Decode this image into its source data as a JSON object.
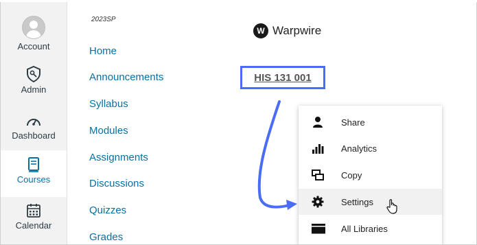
{
  "global_nav": {
    "items": [
      {
        "label": "Account",
        "icon": "avatar"
      },
      {
        "label": "Admin",
        "icon": "shield-icon"
      },
      {
        "label": "Dashboard",
        "icon": "speedometer-icon"
      },
      {
        "label": "Courses",
        "icon": "book-icon",
        "active": true
      },
      {
        "label": "Calendar",
        "icon": "calendar-icon"
      }
    ]
  },
  "course_nav": {
    "term": "2023SP",
    "items": [
      "Home",
      "Announcements",
      "Syllabus",
      "Modules",
      "Assignments",
      "Discussions",
      "Quizzes",
      "Grades"
    ]
  },
  "warpwire": {
    "badge": "W",
    "name": "Warpwire",
    "course_title": "HIS 131 001"
  },
  "menu": {
    "items": [
      {
        "label": "Share",
        "icon": "person-icon"
      },
      {
        "label": "Analytics",
        "icon": "bar-chart-icon"
      },
      {
        "label": "Copy",
        "icon": "copy-icon"
      },
      {
        "label": "Settings",
        "icon": "gear-icon",
        "hover": true
      },
      {
        "label": "All Libraries",
        "icon": "library-icon"
      }
    ]
  },
  "colors": {
    "link": "#0770a3",
    "highlight": "#4a6cf7",
    "nav_bg": "#f2f2f2"
  }
}
